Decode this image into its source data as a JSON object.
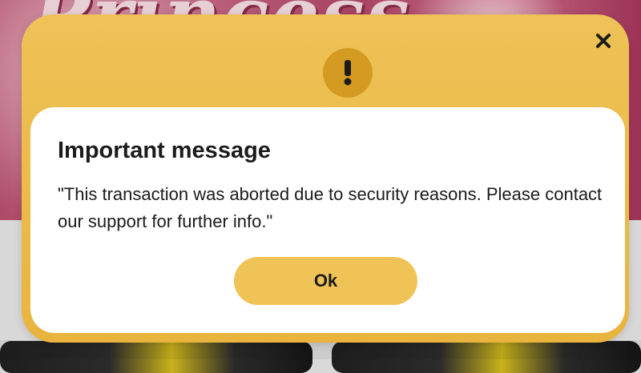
{
  "background": {
    "logo_text": "Princess"
  },
  "modal": {
    "icon": "exclamation-icon",
    "close_icon": "close-icon",
    "title": "Important message",
    "message": "\"This transaction was aborted due to security reasons. Please contact our support for further info.\"",
    "ok_label": "Ok"
  },
  "colors": {
    "modal_accent": "#e9b43d",
    "badge": "#d49b22",
    "ok_button": "#efc356",
    "card": "#ffffff",
    "text": "#1b1b1b"
  }
}
